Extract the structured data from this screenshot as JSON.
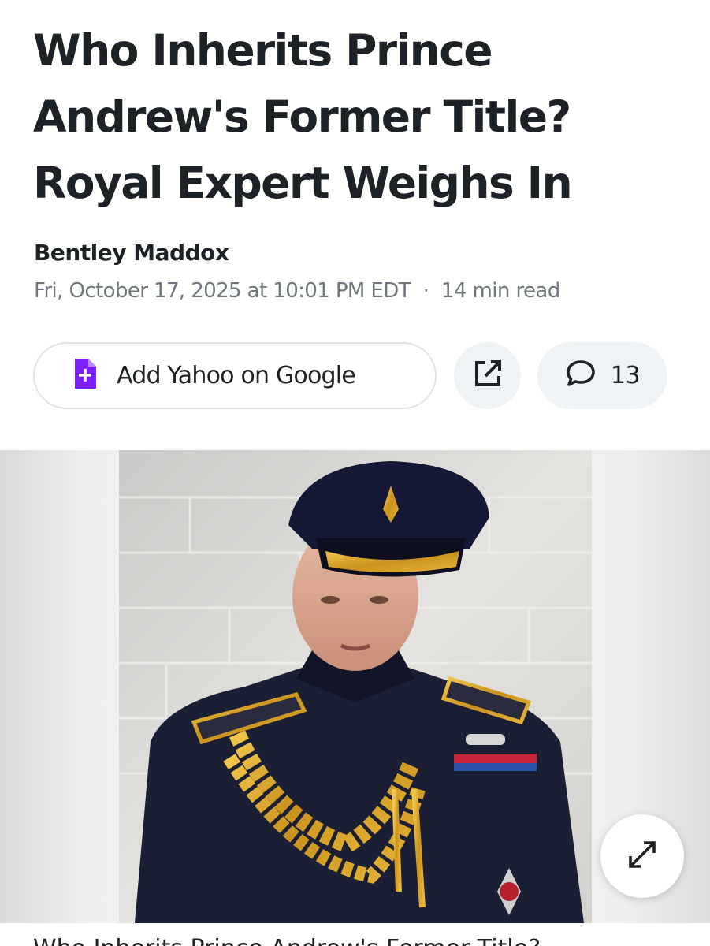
{
  "article": {
    "headline_lines": [
      "Who Inherits Prince",
      "Andrew's Former Title?",
      "Royal Expert Weighs In"
    ],
    "author": "Bentley Maddox",
    "published": "Fri, October 17, 2025 at 10:01 PM EDT",
    "separator": "·",
    "read_time": "14 min read"
  },
  "actions": {
    "add_google_label": "Add Yahoo on Google",
    "add_google_icon": "google-news-plus-icon",
    "share_icon": "external-share-icon",
    "comment_icon": "comment-bubble-icon",
    "comment_count": "13"
  },
  "media": {
    "image_subject": "Prince Andrew in military dress uniform with gold aiguillettes and peaked cap",
    "expand_icon": "expand-arrows-icon"
  },
  "caption": {
    "text": "Who Inherits Prince Andrew's Former Title?"
  },
  "colors": {
    "text": "#1d2228",
    "meta": "#6e7780",
    "accent_purple": "#7e1fff",
    "button_bg": "#f0f3f5",
    "border": "#e0e4e9"
  }
}
